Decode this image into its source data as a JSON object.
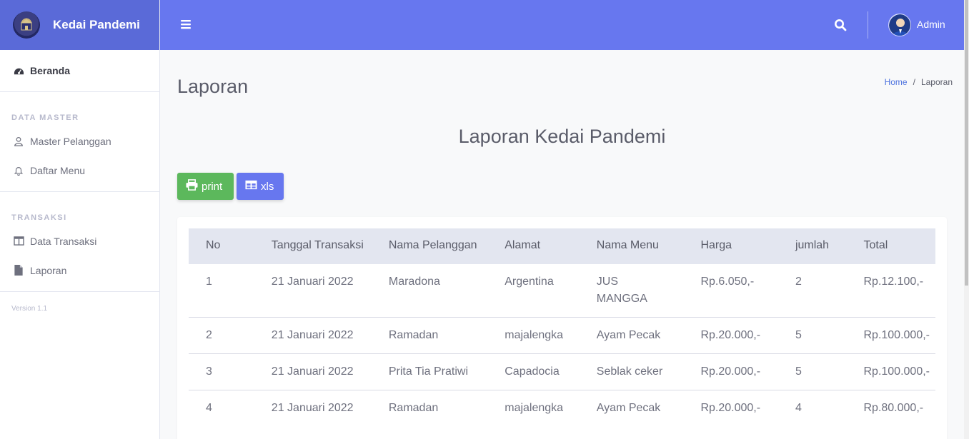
{
  "brand": {
    "name": "Kedai Pandemi"
  },
  "sidebar": {
    "beranda": "Beranda",
    "heading_master": "DATA MASTER",
    "master_pelanggan": "Master Pelanggan",
    "daftar_menu": "Daftar Menu",
    "heading_transaksi": "TRANSAKSI",
    "data_transaksi": "Data Transaksi",
    "laporan": "Laporan",
    "version": "Version 1.1"
  },
  "topbar": {
    "user_name": "Admin"
  },
  "page": {
    "title": "Laporan",
    "breadcrumb": {
      "home": "Home",
      "separator": "/",
      "current": "Laporan"
    },
    "report_title": "Laporan Kedai Pandemi"
  },
  "buttons": {
    "print": "print",
    "xls": "xls"
  },
  "table": {
    "headers": [
      "No",
      "Tanggal Transaksi",
      "Nama Pelanggan",
      "Alamat",
      "Nama Menu",
      "Harga",
      "jumlah",
      "Total"
    ],
    "rows": [
      [
        "1",
        "21 Januari 2022",
        "Maradona",
        "Argentina",
        "JUS MANGGA",
        "Rp.6.050,-",
        "2",
        "Rp.12.100,-"
      ],
      [
        "2",
        "21 Januari 2022",
        "Ramadan",
        "majalengka",
        "Ayam Pecak",
        "Rp.20.000,-",
        "5",
        "Rp.100.000,-"
      ],
      [
        "3",
        "21 Januari 2022",
        "Prita Tia Pratiwi",
        "Capadocia",
        "Seblak ceker",
        "Rp.20.000,-",
        "5",
        "Rp.100.000,-"
      ],
      [
        "4",
        "21 Januari 2022",
        "Ramadan",
        "majalengka",
        "Ayam Pecak",
        "Rp.20.000,-",
        "4",
        "Rp.80.000,-"
      ]
    ]
  },
  "colors": {
    "topbar": "#6777ef",
    "brand": "#5a6ad8",
    "print_button": "#5cb85c",
    "xls_button": "#6777ef"
  }
}
